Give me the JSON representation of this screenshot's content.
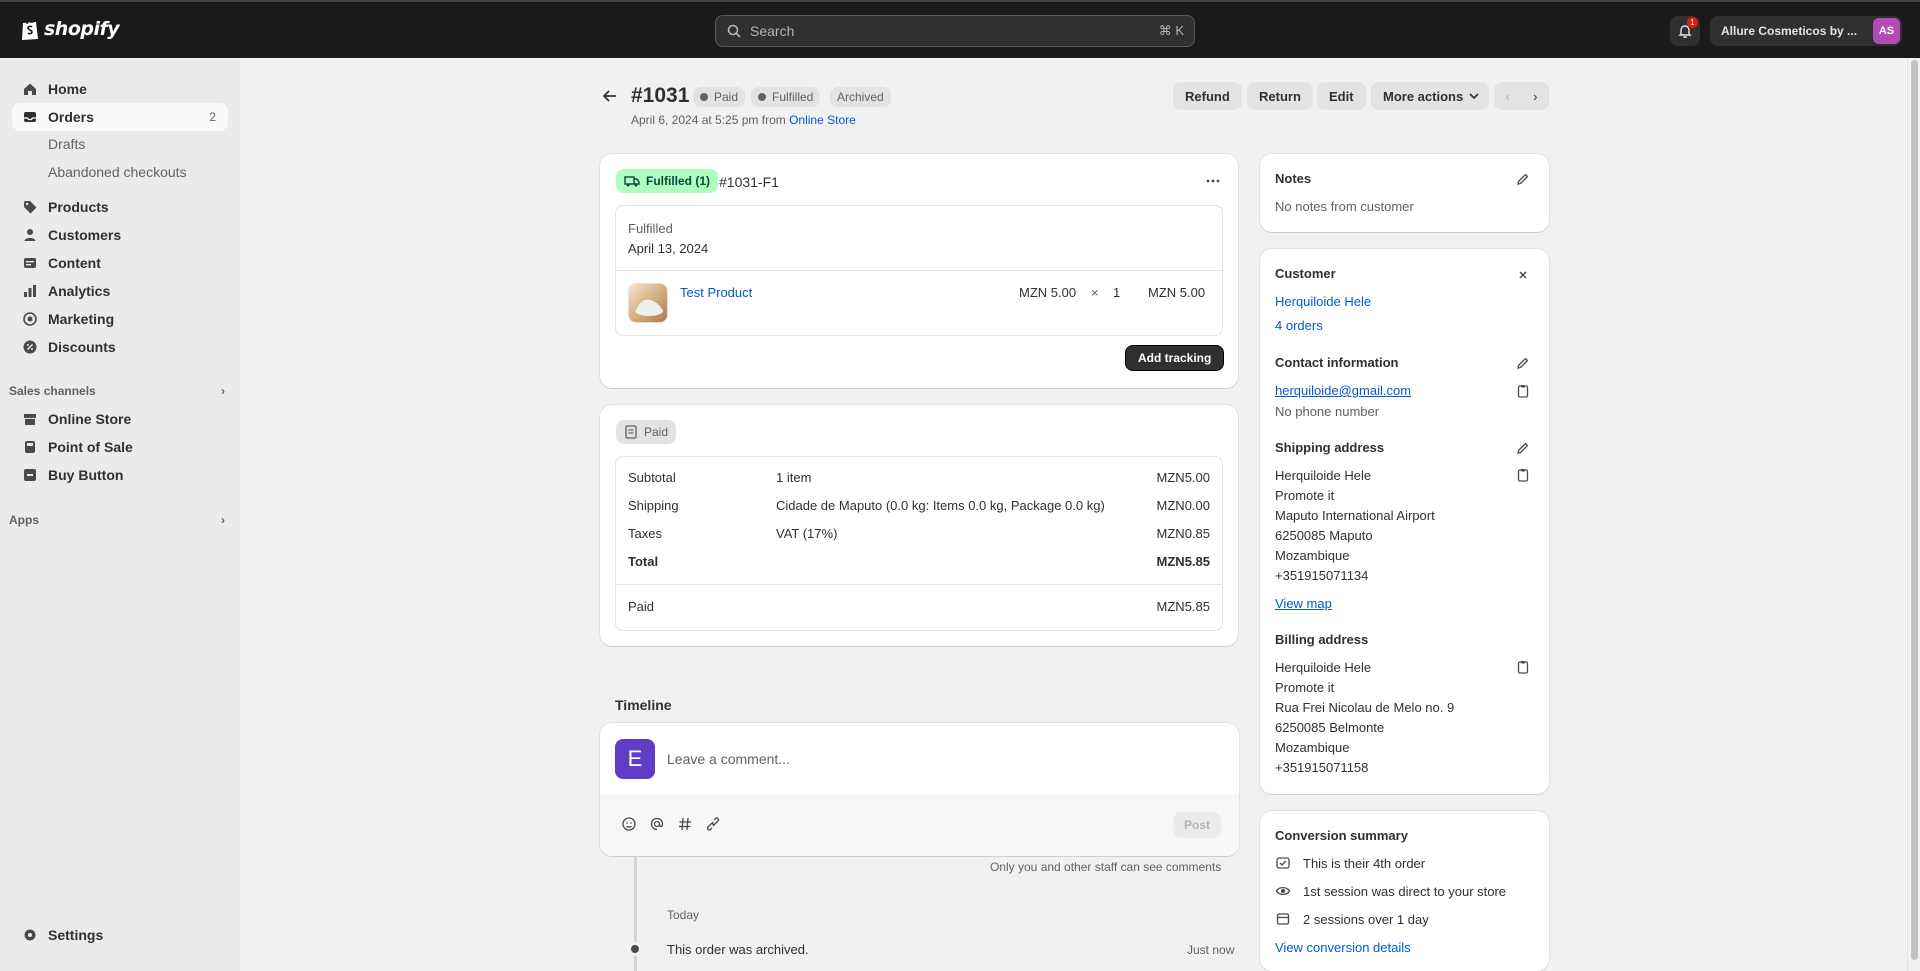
{
  "topbar": {
    "logo_text": "shopify",
    "search_placeholder": "Search",
    "search_shortcut": "⌘ K",
    "notification_count": "1",
    "store_name": "Allure Cosmeticos by ...",
    "store_initials": "AS"
  },
  "sidebar": {
    "home": "Home",
    "orders": "Orders",
    "orders_count": "2",
    "drafts": "Drafts",
    "abandoned": "Abandoned checkouts",
    "products": "Products",
    "customers": "Customers",
    "content": "Content",
    "analytics": "Analytics",
    "marketing": "Marketing",
    "discounts": "Discounts",
    "sales_channels": "Sales channels",
    "online_store": "Online Store",
    "point_of_sale": "Point of Sale",
    "buy_button": "Buy Button",
    "apps": "Apps",
    "settings": "Settings"
  },
  "header": {
    "order_number": "#1031",
    "badge_paid": "Paid",
    "badge_fulfilled": "Fulfilled",
    "badge_archived": "Archived",
    "date_text": "April 6, 2024 at 5:25 pm from",
    "source_link": "Online Store",
    "refund": "Refund",
    "return": "Return",
    "edit": "Edit",
    "more_actions": "More actions"
  },
  "fulfillment": {
    "badge": "Fulfilled (1)",
    "id": "#1031-F1",
    "status": "Fulfilled",
    "date": "April 13, 2024",
    "product_name": "Test Product",
    "unit_price": "MZN 5.00",
    "times": "×",
    "quantity": "1",
    "line_total": "MZN 5.00",
    "add_tracking": "Add tracking"
  },
  "payment": {
    "badge": "Paid",
    "rows": [
      {
        "label": "Subtotal",
        "detail": "1 item",
        "amount": "MZN5.00"
      },
      {
        "label": "Shipping",
        "detail": "Cidade de Maputo (0.0 kg: Items 0.0 kg, Package 0.0 kg)",
        "amount": "MZN0.00"
      },
      {
        "label": "Taxes",
        "detail": "VAT (17%)",
        "amount": "MZN0.85"
      },
      {
        "label": "Total",
        "detail": "",
        "amount": "MZN5.85"
      }
    ],
    "paid_label": "Paid",
    "paid_amount": "MZN5.85"
  },
  "timeline": {
    "title": "Timeline",
    "avatar_letter": "E",
    "comment_placeholder": "Leave a comment...",
    "post": "Post",
    "staff_note": "Only you and other staff can see comments",
    "today": "Today",
    "event_text": "This order was archived.",
    "event_time": "Just now"
  },
  "notes": {
    "title": "Notes",
    "text": "No notes from customer"
  },
  "customer": {
    "title": "Customer",
    "name": "Herquiloide Hele",
    "orders": "4 orders",
    "contact_title": "Contact information",
    "email": "herquiloide@gmail.com",
    "phone": "No phone number",
    "shipping_title": "Shipping address",
    "shipping_lines": [
      "Herquiloide Hele",
      "Promote it",
      "Maputo International Airport",
      "6250085 Maputo",
      "Mozambique",
      "+351915071134"
    ],
    "view_map": "View map",
    "billing_title": "Billing address",
    "billing_lines": [
      "Herquiloide Hele",
      "Promote it",
      "Rua Frei Nicolau de Melo no. 9",
      "6250085 Belmonte",
      "Mozambique",
      "+351915071158"
    ]
  },
  "conversion": {
    "title": "Conversion summary",
    "items": [
      "This is their 4th order",
      "1st session was direct to your store",
      "2 sessions over 1 day"
    ],
    "link": "View conversion details"
  }
}
